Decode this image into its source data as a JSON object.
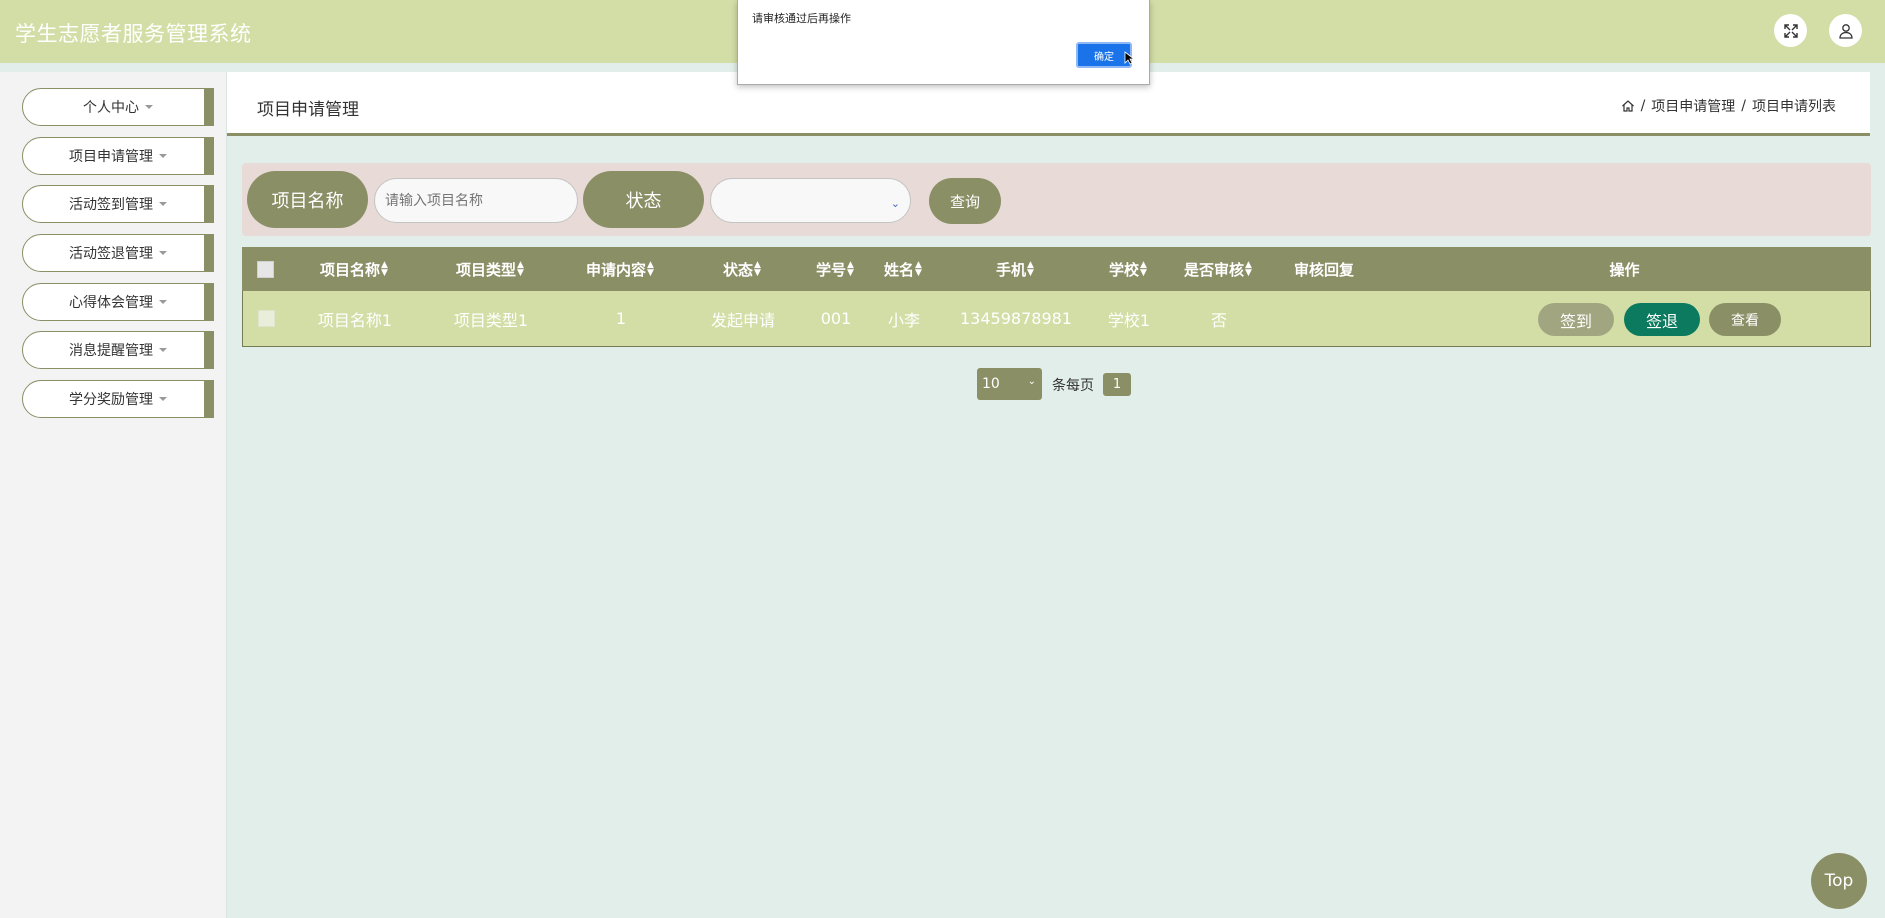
{
  "app": {
    "title": "学生志愿者服务管理系统"
  },
  "header": {
    "expand_icon": "expand-icon",
    "user_icon": "user-icon"
  },
  "sidebar": {
    "items": [
      {
        "label": "个人中心"
      },
      {
        "label": "项目申请管理"
      },
      {
        "label": "活动签到管理"
      },
      {
        "label": "活动签退管理"
      },
      {
        "label": "心得体会管理"
      },
      {
        "label": "消息提醒管理"
      },
      {
        "label": "学分奖励管理"
      }
    ]
  },
  "page": {
    "title": "项目申请管理"
  },
  "breadcrumb": {
    "items": [
      "项目申请管理",
      "项目申请列表"
    ],
    "separator": "/"
  },
  "search": {
    "name_label": "项目名称",
    "name_placeholder": "请输入项目名称",
    "status_label": "状态",
    "status_value": "",
    "query_label": "查询"
  },
  "table": {
    "columns": [
      "项目名称",
      "项目类型",
      "申请内容",
      "状态",
      "学号",
      "姓名",
      "手机",
      "学校",
      "是否审核",
      "审核回复",
      "操作"
    ],
    "rows": [
      {
        "name": "项目名称1",
        "type": "项目类型1",
        "content": "1",
        "status": "发起申请",
        "student_id": "001",
        "student_name": "小李",
        "phone": "13459878981",
        "school": "学校1",
        "reviewed": "否",
        "reply": "",
        "actions": [
          "签到",
          "签退",
          "查看"
        ]
      }
    ]
  },
  "pagination": {
    "page_size": "10",
    "per_page_label": "条每页",
    "current_page": "1"
  },
  "top_button": "Top",
  "alert": {
    "message": "请审核通过后再操作",
    "ok_label": "确定"
  },
  "colors": {
    "primary": "#8b8f66",
    "header": "#d3dea7",
    "accent": "#0b7a5e",
    "background": "#e2eee9"
  }
}
